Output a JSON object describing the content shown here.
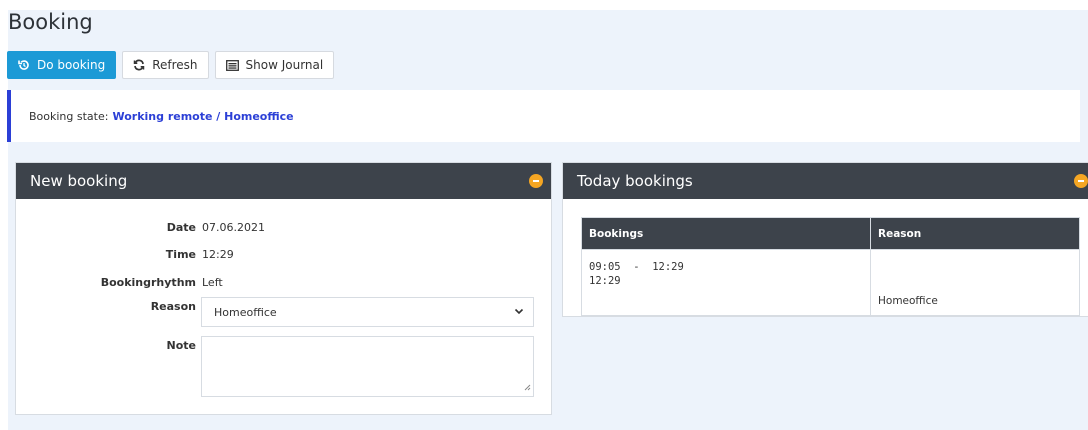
{
  "page": {
    "title": "Booking"
  },
  "toolbar": {
    "do_booking": "Do booking",
    "refresh": "Refresh",
    "show_journal": "Show Journal"
  },
  "state": {
    "label": "Booking state:",
    "value": "Working remote / Homeoffice"
  },
  "new_booking": {
    "title": "New booking",
    "date_label": "Date",
    "date_value": "07.06.2021",
    "time_label": "Time",
    "time_value": "12:29",
    "rhythm_label": "Bookingrhythm",
    "rhythm_value": "Left",
    "reason_label": "Reason",
    "reason_value": "Homeoffice",
    "note_label": "Note",
    "note_value": ""
  },
  "today": {
    "title": "Today bookings",
    "columns": [
      "Bookings",
      "Reason"
    ],
    "rows": [
      {
        "line1": "09:05  -  12:29",
        "line2": "12:29",
        "reason": "Homeoffice"
      }
    ]
  },
  "colors": {
    "primary": "#1c9ad6",
    "accent_blue": "#2b3fd6",
    "panel_header": "#3d434b",
    "collapse_orange": "#f5a623",
    "page_bg": "#edf3fb"
  }
}
